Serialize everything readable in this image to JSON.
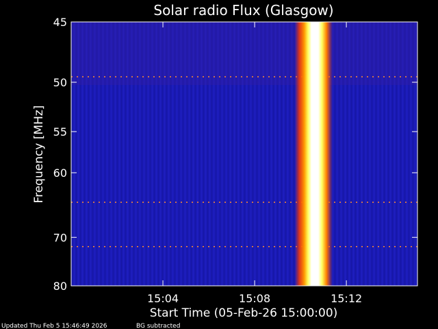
{
  "chart_data": {
    "type": "heatmap",
    "title": "Solar radio Flux (Glasgow)",
    "xlabel": "Start Time (05-Feb-26 15:00:00)",
    "ylabel": "Frequency [MHz]",
    "x_unit": "minutes after 15:00:00",
    "xlim": [
      0.0,
      15.1
    ],
    "ylim": [
      80,
      45
    ],
    "y_scale": "reciprocal",
    "x_ticks": [
      {
        "value": 4,
        "label": "15:04"
      },
      {
        "value": 8,
        "label": "15:08"
      },
      {
        "value": 12,
        "label": "15:12"
      }
    ],
    "y_ticks": [
      {
        "value": 45,
        "label": "45"
      },
      {
        "value": 50,
        "label": "50"
      },
      {
        "value": 55,
        "label": "55"
      },
      {
        "value": 60,
        "label": "60"
      },
      {
        "value": 70,
        "label": "70"
      },
      {
        "value": 80,
        "label": "80"
      }
    ],
    "burst": {
      "t_start": 9.75,
      "t_peak": 10.55,
      "t_end": 11.4,
      "f_low": 45,
      "f_high": 80
    },
    "rfi_lines_mhz": [
      49.5,
      64.2,
      71.7
    ],
    "background_color": "#1a1ab4",
    "burst_core_color": "#ffffff",
    "burst_edge_color": "#ff5a00"
  },
  "footer": {
    "updated": "Updated Thu Feb  5 15:46:49 2026",
    "note": "BG subtracted"
  }
}
